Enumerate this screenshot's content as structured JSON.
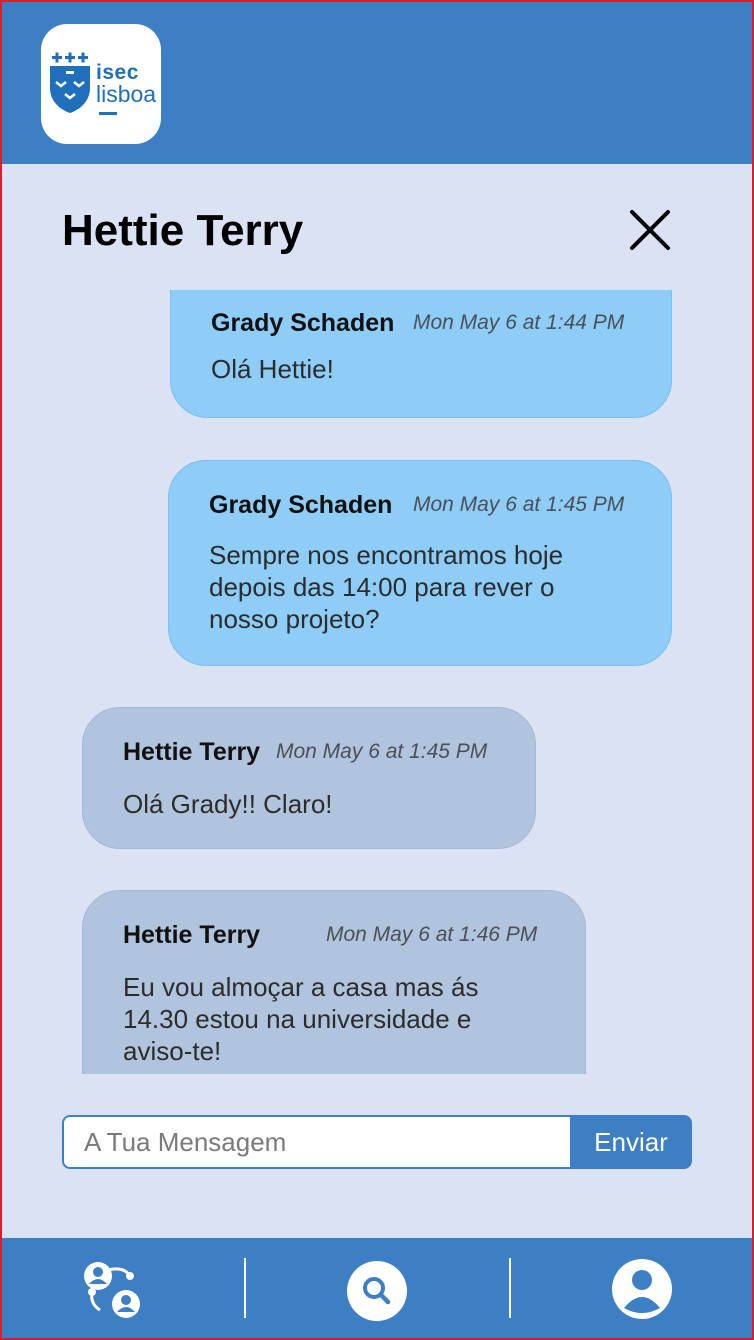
{
  "app": {
    "logo": {
      "line1": "isec",
      "line2": "lisboa"
    }
  },
  "colors": {
    "primary": "#3d7fc4",
    "background": "#dbe2f4",
    "sent_bubble": "#8ecdf7",
    "received_bubble": "#b1c4dd"
  },
  "chat": {
    "title": "Hettie Terry",
    "close_icon": "close-icon",
    "messages": [
      {
        "sender": "Grady Schaden",
        "time": "Mon May 6 at 1:44 PM",
        "lines": [
          "Olá Hettie!"
        ],
        "direction": "sent"
      },
      {
        "sender": "Grady Schaden",
        "time": "Mon May 6 at 1:45 PM",
        "lines": [
          "Sempre nos encontramos hoje",
          "depois das 14:00 para rever o",
          "nosso projeto?"
        ],
        "direction": "sent"
      },
      {
        "sender": "Hettie Terry",
        "time": "Mon May 6 at 1:45 PM",
        "lines": [
          "Olá Grady!! Claro!"
        ],
        "direction": "received"
      },
      {
        "sender": "Hettie Terry",
        "time": "Mon May 6 at 1:46 PM",
        "lines": [
          "Eu vou almoçar a casa mas ás",
          "14.30 estou na universidade e",
          "aviso-te!"
        ],
        "direction": "received"
      }
    ]
  },
  "composer": {
    "placeholder": "A Tua Mensagem",
    "value": "",
    "send_label": "Enviar"
  },
  "bottom_nav": {
    "items": [
      {
        "icon": "users-network-icon"
      },
      {
        "icon": "search-icon"
      },
      {
        "icon": "user-profile-icon"
      }
    ]
  }
}
